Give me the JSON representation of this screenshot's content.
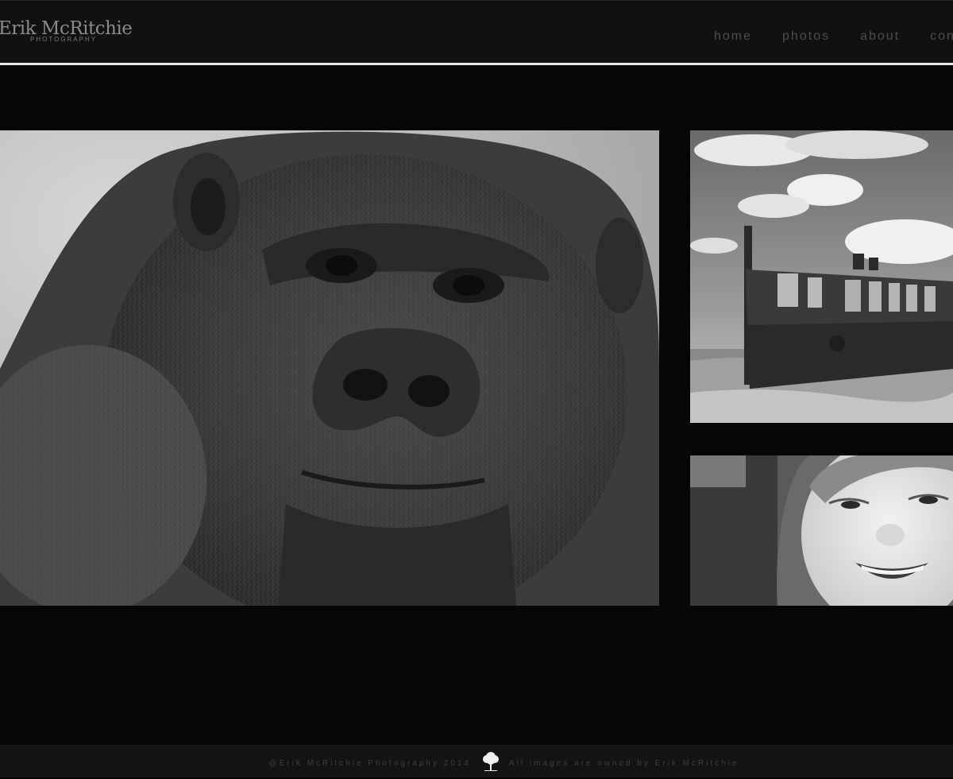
{
  "site": {
    "logo_name": "Erik McRitchie",
    "logo_subtitle": "PHOTOGRAPHY"
  },
  "nav": {
    "items": [
      {
        "label": "home"
      },
      {
        "label": "photos"
      },
      {
        "label": "about"
      },
      {
        "label": "contact"
      }
    ]
  },
  "gallery": {
    "photos": [
      {
        "subject": "gorilla portrait"
      },
      {
        "subject": "shipwreck on beach"
      },
      {
        "subject": "smiling child"
      }
    ]
  },
  "footer": {
    "copyright": "@Erik McRitchie Photography 2014",
    "rights": "All images are owned by Erik McRitchie",
    "icon": "tree-icon"
  },
  "colors": {
    "background": "#060606",
    "header": "#111111",
    "rule": "#e8e8e8",
    "nav_text": "#4c4c4c",
    "footer_text": "#3e3e3e"
  }
}
